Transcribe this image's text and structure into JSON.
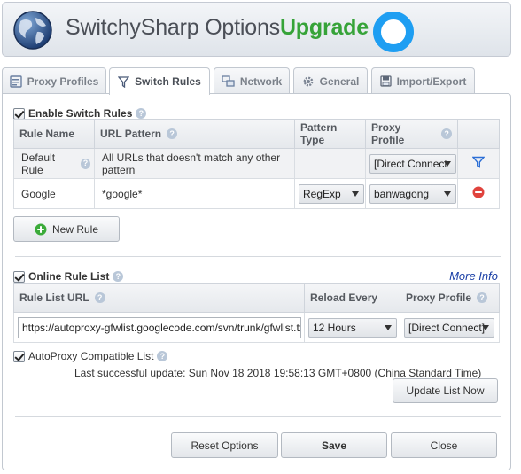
{
  "header": {
    "title": "SwitchySharp Options",
    "upgrade": "Upgrade"
  },
  "tabs": [
    {
      "label": "Proxy Profiles",
      "icon": "profiles-icon"
    },
    {
      "label": "Switch Rules",
      "icon": "funnel-icon"
    },
    {
      "label": "Network",
      "icon": "network-icon"
    },
    {
      "label": "General",
      "icon": "gear-icon"
    },
    {
      "label": "Import/Export",
      "icon": "floppy-icon"
    }
  ],
  "switch_rules": {
    "enable_label": "Enable Switch Rules",
    "columns": [
      "Rule Name",
      "URL Pattern",
      "Pattern Type",
      "Proxy Profile"
    ],
    "default_rule": {
      "name": "Default Rule",
      "pattern": "All URLs that doesn't match any other pattern",
      "profile": "[Direct Connect"
    },
    "rules": [
      {
        "name": "Google",
        "pattern": "*google*",
        "type": "RegExp",
        "profile": "banwagong"
      }
    ],
    "new_rule_label": "New Rule"
  },
  "online_list": {
    "enable_label": "Online Rule List",
    "more_info": "More Info",
    "columns": [
      "Rule List URL",
      "Reload Every",
      "Proxy Profile"
    ],
    "url": "https://autoproxy-gfwlist.googlecode.com/svn/trunk/gfwlist.txt",
    "reload": "12 Hours",
    "profile": "[Direct Connect]",
    "autoproxy_label": "AutoProxy Compatible List",
    "last_update": "Last successful update: Sun Nov 18 2018 19:58:13 GMT+0800 (China Standard Time)",
    "update_button": "Update List Now"
  },
  "footer": {
    "reset": "Reset Options",
    "save": "Save",
    "close": "Close"
  },
  "colors": {
    "accent": "#1e9ef2",
    "upgrade": "#36a338",
    "link": "#1a3fa6"
  }
}
